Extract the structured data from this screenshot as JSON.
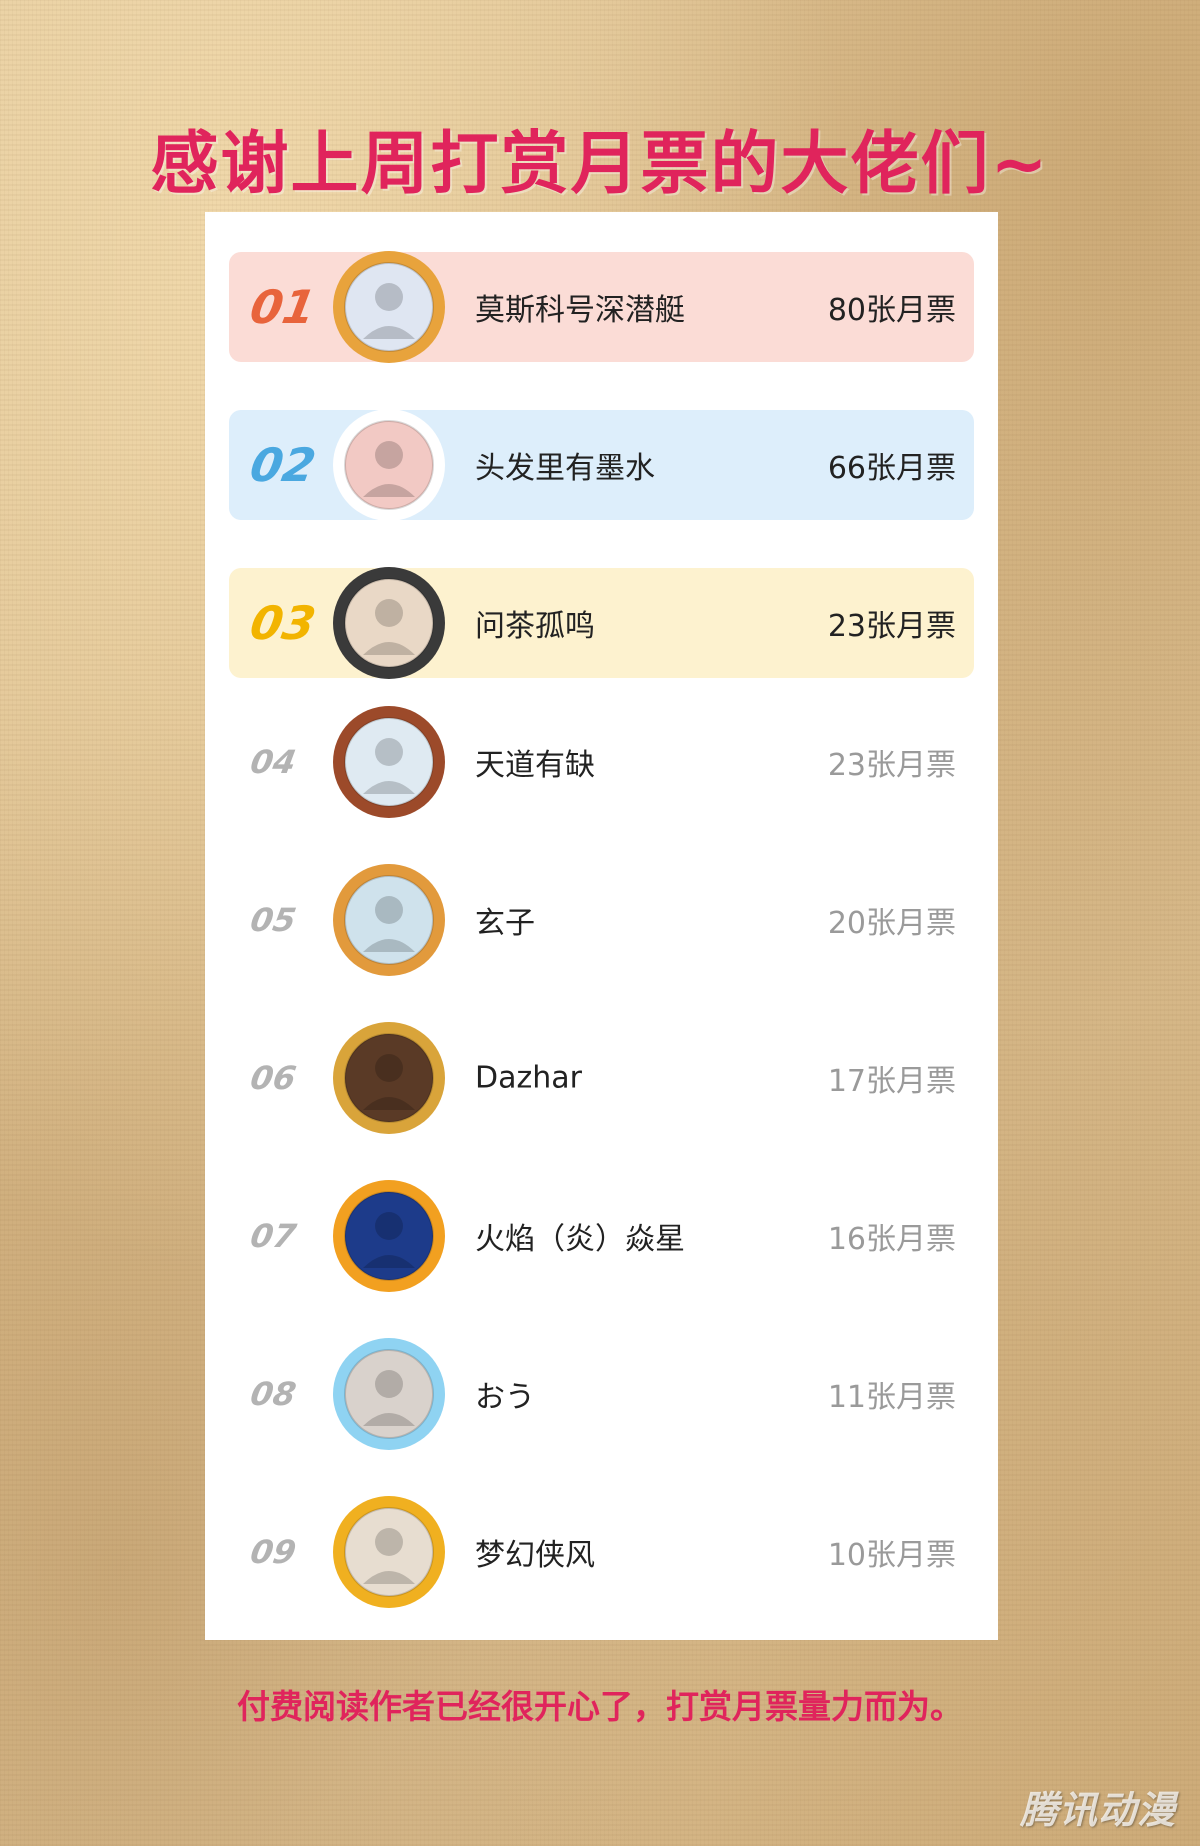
{
  "title": "感谢上周打赏月票的大佬们~",
  "colors": {
    "title": "#e0245c",
    "rank_1": "#e8643c",
    "rank_2": "#4aa8e0",
    "rank_3": "#f2b400",
    "rank_rest": "#b3b3b3",
    "row_bg_1": "#fbdcd6",
    "row_bg_2": "#ddeefb",
    "row_bg_3": "#fdf2cf"
  },
  "ranking": [
    {
      "rank": "01",
      "name": "莫斯科号深潜艇",
      "votes": "80张月票",
      "avatar_icon": "astronaut-badge-icon",
      "frame_color": "#e8a33c",
      "face_color": "#dfe6f2"
    },
    {
      "rank": "02",
      "name": "头发里有墨水",
      "votes": "66张月票",
      "avatar_icon": "sheep-cartoon-icon",
      "frame_color": "#ffffff",
      "face_color": "#f2c9c4"
    },
    {
      "rank": "03",
      "name": "问茶孤鸣",
      "votes": "23张月票",
      "avatar_icon": "survivor-badge-icon",
      "frame_color": "#3a3a3a",
      "face_color": "#e9d8c6"
    },
    {
      "rank": "04",
      "name": "天道有缺",
      "votes": "23张月票",
      "avatar_icon": "landscape-wreath-icon",
      "frame_color": "#9c4a2a",
      "face_color": "#dfeaf2"
    },
    {
      "rank": "05",
      "name": "玄子",
      "votes": "20张月票",
      "avatar_icon": "opera-portrait-icon",
      "frame_color": "#e29a3c",
      "face_color": "#cfe2ec"
    },
    {
      "rank": "06",
      "name": "Dazhar",
      "votes": "17张月票",
      "avatar_icon": "clock-frame-icon",
      "frame_color": "#d9a43a",
      "face_color": "#5a3a26"
    },
    {
      "rank": "07",
      "name": "火焰（炎）焱星",
      "votes": "16张月票",
      "avatar_icon": "tiger-frame-icon",
      "frame_color": "#f2a020",
      "face_color": "#1d3b8a"
    },
    {
      "rank": "08",
      "name": "おう",
      "votes": "11张月票",
      "avatar_icon": "anime-character-icon",
      "frame_color": "#8fd3f2",
      "face_color": "#d9d2cc"
    },
    {
      "rank": "09",
      "name": "梦幻侠风",
      "votes": "10张月票",
      "avatar_icon": "flower-frame-icon",
      "frame_color": "#f0b020",
      "face_color": "#e7ddd0"
    }
  ],
  "footer": "付费阅读作者已经很开心了，打赏月票量力而为。",
  "watermark": "腾讯动漫"
}
